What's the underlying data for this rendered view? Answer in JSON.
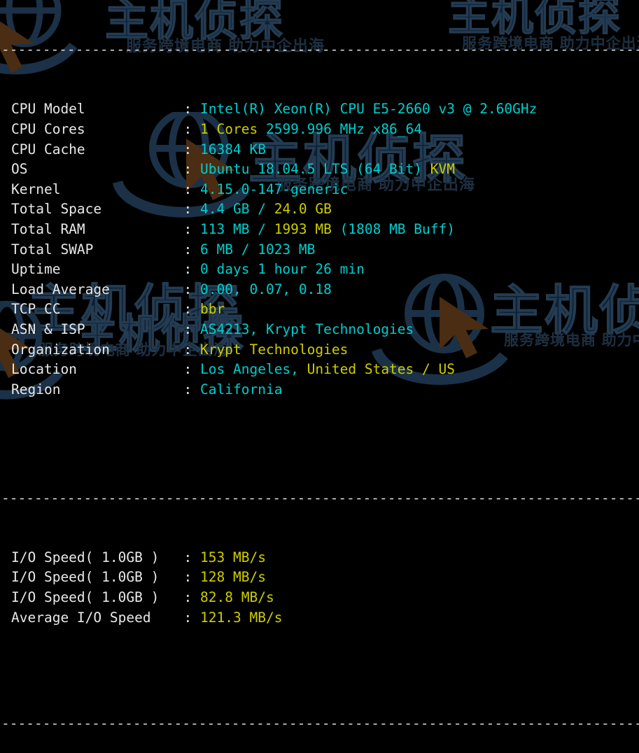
{
  "terminal": {
    "rule_top": "-------------------------------------------------------------",
    "rule_mid": "-------------------------------------------------------------",
    "rule_bottom": "-------------------------------------------------------------",
    "colon": ":",
    "info_rows": [
      {
        "key": "CPU Model",
        "parts": [
          {
            "t": "Intel(R) Xeon(R) CPU E5-2660 v3 @ 2.60GHz",
            "c": "c"
          }
        ]
      },
      {
        "key": "CPU Cores",
        "parts": [
          {
            "t": "1 Cores",
            "c": "y"
          },
          {
            "t": " 2599.996 MHz x86_64",
            "c": "c"
          }
        ]
      },
      {
        "key": "CPU Cache",
        "parts": [
          {
            "t": "16384 KB",
            "c": "c"
          }
        ]
      },
      {
        "key": "OS",
        "parts": [
          {
            "t": "Ubuntu 18.04.5 LTS (64 Bit)",
            "c": "c"
          },
          {
            "t": " KVM",
            "c": "y"
          }
        ]
      },
      {
        "key": "Kernel",
        "parts": [
          {
            "t": "4.15.0-147-generic",
            "c": "c"
          }
        ]
      },
      {
        "key": "Total Space",
        "parts": [
          {
            "t": "4.4 GB / ",
            "c": "c"
          },
          {
            "t": "24.0 GB",
            "c": "y"
          }
        ]
      },
      {
        "key": "Total RAM",
        "parts": [
          {
            "t": "113 MB / ",
            "c": "c"
          },
          {
            "t": "1993 MB",
            "c": "y"
          },
          {
            "t": " (1808 MB Buff)",
            "c": "c"
          }
        ]
      },
      {
        "key": "Total SWAP",
        "parts": [
          {
            "t": "6 MB / 1023 MB",
            "c": "c"
          }
        ]
      },
      {
        "key": "Uptime",
        "parts": [
          {
            "t": "0 days 1 hour 26 min",
            "c": "c"
          }
        ]
      },
      {
        "key": "Load Average",
        "parts": [
          {
            "t": "0.00, 0.07, 0.18",
            "c": "c"
          }
        ]
      },
      {
        "key": "TCP CC",
        "parts": [
          {
            "t": "bbr",
            "c": "y"
          }
        ]
      },
      {
        "key": "ASN & ISP",
        "parts": [
          {
            "t": "AS4213, Krypt Technologies",
            "c": "c"
          }
        ]
      },
      {
        "key": "Organization",
        "parts": [
          {
            "t": "Krypt Technologies",
            "c": "y"
          }
        ]
      },
      {
        "key": "Location",
        "parts": [
          {
            "t": "Los Angeles,",
            "c": "c"
          },
          {
            "t": " United States / US",
            "c": "y"
          }
        ]
      },
      {
        "key": "Region",
        "parts": [
          {
            "t": "California",
            "c": "c"
          }
        ]
      }
    ],
    "io_rows": [
      {
        "key": "I/O Speed( 1.0GB )",
        "parts": [
          {
            "t": "153 MB/s",
            "c": "y"
          }
        ]
      },
      {
        "key": "I/O Speed( 1.0GB )",
        "parts": [
          {
            "t": "128 MB/s",
            "c": "y"
          }
        ]
      },
      {
        "key": "I/O Speed( 1.0GB )",
        "parts": [
          {
            "t": "82.8 MB/s",
            "c": "y"
          }
        ]
      },
      {
        "key": "Average I/O Speed",
        "parts": [
          {
            "t": "121.3 MB/s",
            "c": "y"
          }
        ]
      }
    ]
  },
  "watermark": {
    "logo_text": "主机侦探",
    "tagline": "服务跨境电商 助力中企出海",
    "logo_color": "#0d2136",
    "tagline_color": "#14283c",
    "cursor_color": "#4a2d12"
  },
  "colors": {
    "background": "#000000",
    "key_text": "#e8e8e8",
    "cyan_value": "#00cdcd",
    "yellow_value": "#cdcd00"
  }
}
